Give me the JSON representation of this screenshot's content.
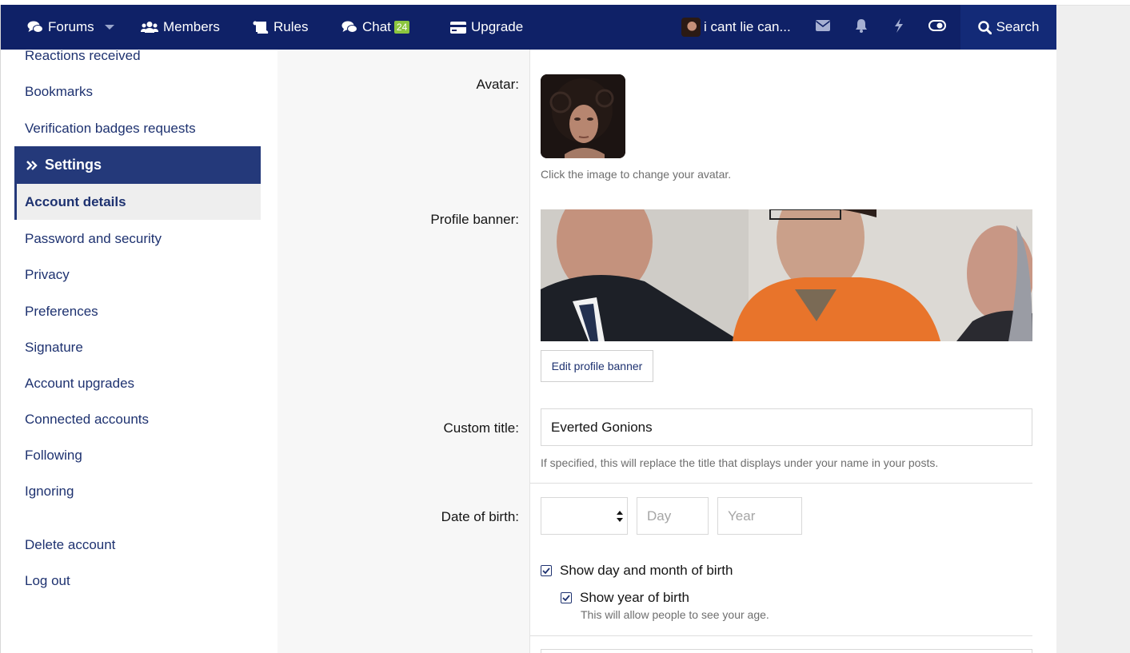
{
  "nav": {
    "forums": "Forums",
    "members": "Members",
    "rules": "Rules",
    "chat": "Chat",
    "chat_badge": "24",
    "upgrade": "Upgrade",
    "username": "i cant lie can...",
    "search": "Search"
  },
  "sidebar": {
    "items_top": [
      "Reactions received",
      "Bookmarks",
      "Verification badges requests"
    ],
    "section_title": "Settings",
    "active_item": "Account details",
    "items": [
      "Password and security",
      "Privacy",
      "Preferences",
      "Signature",
      "Account upgrades",
      "Connected accounts",
      "Following",
      "Ignoring"
    ],
    "items_bottom": [
      "Delete account",
      "Log out"
    ]
  },
  "form": {
    "avatar_label": "Avatar:",
    "avatar_hint": "Click the image to change your avatar.",
    "banner_label": "Profile banner:",
    "edit_banner_button": "Edit profile banner",
    "custom_title_label": "Custom title:",
    "custom_title_value": "Everted Gonions",
    "custom_title_hint": "If specified, this will replace the title that displays under your name in your posts.",
    "dob_label": "Date of birth:",
    "day_placeholder": "Day",
    "year_placeholder": "Year",
    "show_day_month": "Show day and month of birth",
    "show_day_month_checked": true,
    "show_year": "Show year of birth",
    "show_year_checked": true,
    "show_year_hint": "This will allow people to see your age."
  },
  "colors": {
    "nav_bg": "#0f2167",
    "accent": "#24397a",
    "link": "#1e3270",
    "badge": "#8cc63f"
  }
}
